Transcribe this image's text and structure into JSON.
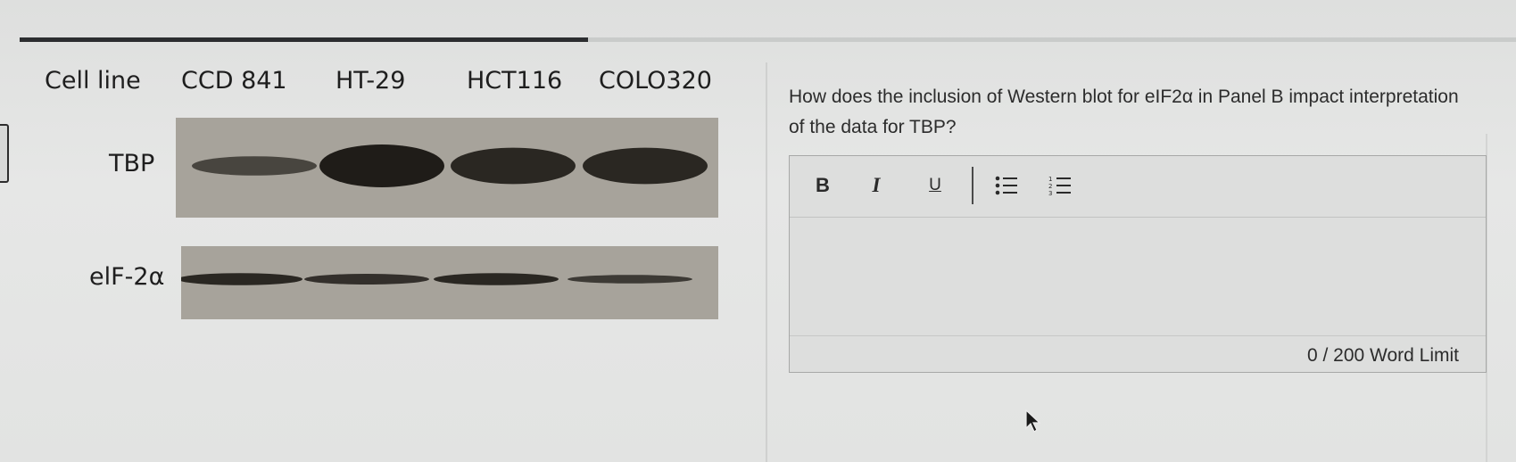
{
  "progress": {
    "percent": 38
  },
  "figure": {
    "header_label": "Cell line",
    "cell_lines": [
      "CCD 841",
      "HT-29",
      "HCT116",
      "COLO320"
    ],
    "rows": [
      {
        "label": "TBP",
        "band_intensity": [
          0.45,
          1.0,
          0.85,
          0.85
        ]
      },
      {
        "label": "elF-2α",
        "band_intensity": [
          0.85,
          0.75,
          0.85,
          0.6
        ]
      }
    ]
  },
  "question": {
    "text": "How does the inclusion of Western blot for eIF2α in Panel B impact interpretation of the data for TBP?"
  },
  "editor": {
    "toolbar": {
      "bold_label": "B",
      "italic_label": "I",
      "underline_label": "U",
      "bullet_list_icon": "bulleted-list-icon",
      "numbered_list_icon": "numbered-list-icon"
    },
    "value": "",
    "word_count": "0 / 200 Word Limit"
  },
  "colors": {
    "accent": "#2c2d30",
    "text": "#2c2c2c",
    "band": "#1f1c18"
  }
}
